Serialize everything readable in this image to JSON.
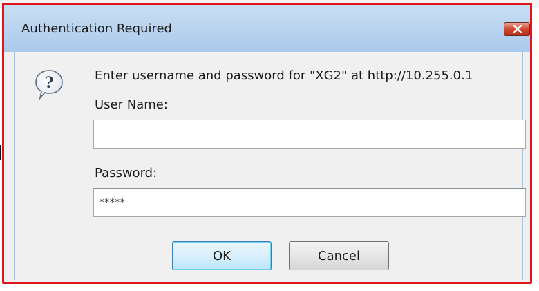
{
  "dialog": {
    "title": "Authentication Required",
    "close_icon": "close-x-icon",
    "prompt": "Enter username and password for \"XG2\" at http://10.255.0.1",
    "prompt_icon": "question-speech-bubble-icon",
    "username": {
      "label": "User Name:",
      "value": ""
    },
    "password": {
      "label": "Password:",
      "value": "*****"
    },
    "ok_label": "OK",
    "cancel_label": "Cancel"
  },
  "colors": {
    "frame_highlight": "#e0141b",
    "titlebar": "#b8d3ef",
    "close_button": "#cf4a34",
    "dialog_background": "#f0f0f0"
  }
}
